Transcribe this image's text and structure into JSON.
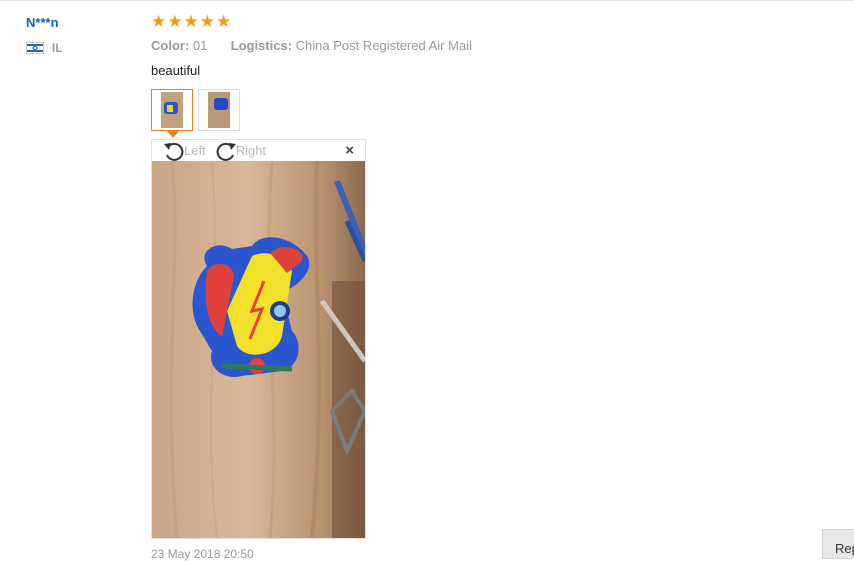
{
  "review": {
    "username": "N***n",
    "country_code": "IL",
    "rating": 5,
    "color_label": "Color:",
    "color_value": "01",
    "logistics_label": "Logistics:",
    "logistics_value": "China Post Registered Air Mail",
    "text": "beautiful",
    "date": "23 May 2018 20:50"
  },
  "viewer": {
    "rotate_left_label": "Left",
    "rotate_right_label": "Right",
    "close_glyph": "×"
  },
  "actions": {
    "report_label": "Report"
  },
  "colors": {
    "username": "#1c5fb0",
    "star": "#f39c12",
    "active_thumb_border": "#e6801e"
  }
}
